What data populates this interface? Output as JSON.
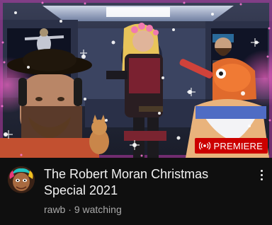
{
  "video": {
    "title": "The Robert Moran Christmas Special 2021",
    "channel": "rawb",
    "separator": "·",
    "watching": "9 watching",
    "badge_label": "PREMIERE",
    "badge_icon": "live-broadcast-icon",
    "menu_icon": "more-vert-icon"
  },
  "colors": {
    "badge_bg": "#cc0000",
    "title": "#f1f1f1",
    "subtext": "#aaaaaa",
    "background": "#0f0f0f"
  }
}
